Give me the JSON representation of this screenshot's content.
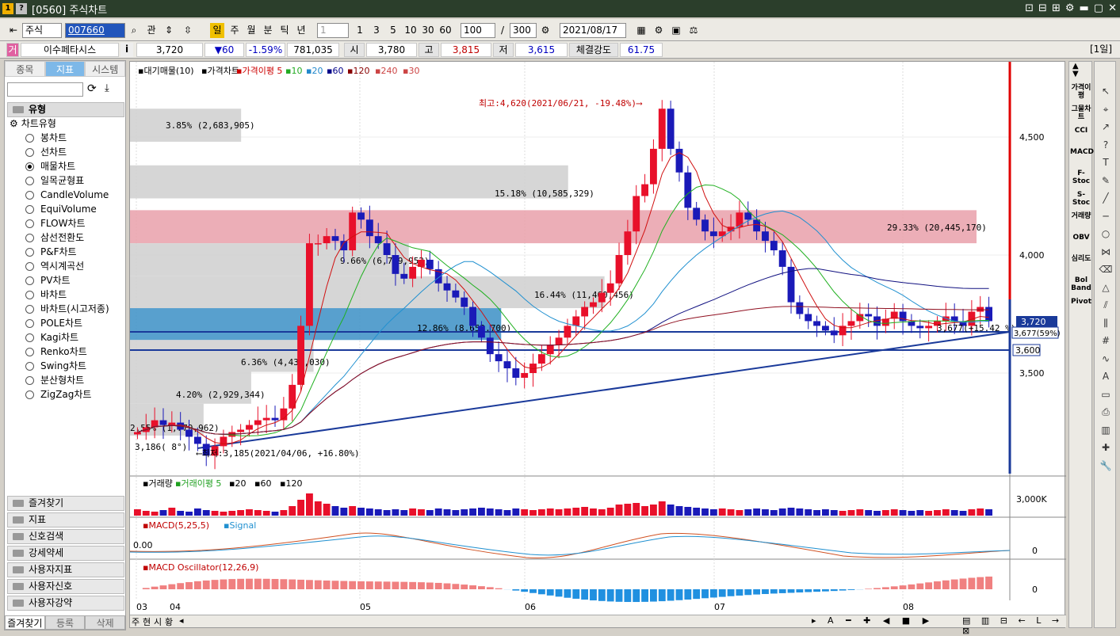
{
  "window": {
    "title": "[0560] 주식차트",
    "logo1": "1",
    "logo2": "?",
    "controls": [
      "⊡",
      "⊟",
      "⊞",
      "⚙",
      "▬",
      "▢",
      "✕"
    ]
  },
  "toolbar": {
    "market": "주식",
    "code": "007660",
    "gwan": "관",
    "periods": [
      "일",
      "주",
      "월",
      "분",
      "틱",
      "년"
    ],
    "tick_select": "1",
    "tick_options": [
      "1",
      "3",
      "5",
      "10",
      "30",
      "60"
    ],
    "count": "100",
    "total": "300",
    "date": "2021/08/17"
  },
  "info": {
    "name": "이수페타시스",
    "price": "3,720",
    "change": "▼60",
    "change_pct": "-1.59%",
    "volume": "781,035",
    "open_label": "시",
    "open": "3,780",
    "high_label": "고",
    "high": "3,815",
    "low_label": "저",
    "low": "3,615",
    "strength_label": "체결강도",
    "strength": "61.75",
    "period_badge": "[1일]",
    "prefix": "거",
    "i": "i"
  },
  "left": {
    "tabs": [
      "종목",
      "지표",
      "시스템"
    ],
    "section": "유형",
    "tree_label": "차트유형",
    "chart_types": [
      "봉차트",
      "선차트",
      "매물차트",
      "일목균형표",
      "CandleVolume",
      "EquiVolume",
      "FLOW차트",
      "삼선전환도",
      "P&F차트",
      "역시계곡선",
      "PV차트",
      "바차트",
      "바차트(시고저종)",
      "POLE차트",
      "Kagi차트",
      "Renko차트",
      "Swing차트",
      "분산형차트",
      "ZigZag차트"
    ],
    "selected_index": 2,
    "sections": [
      "즐겨찾기",
      "지표",
      "신호검색",
      "강세약세",
      "사용자지표",
      "사용자신호",
      "사용자강약"
    ],
    "bottom_tabs": [
      "즐겨찾기",
      "등록",
      "삭제"
    ]
  },
  "chart": {
    "legend_main": [
      "대기매물(10)",
      "가격차트",
      "가격이평 5",
      "10",
      "20",
      "60",
      "120",
      "240",
      "30"
    ],
    "legend_colors": [
      "#000",
      "#000",
      "#c00",
      "#2a2",
      "#28c",
      "#008",
      "#800",
      "#c44",
      "#c44"
    ],
    "profile_labels": [
      "3.85% (2,683,905)",
      "15.18% (10,585,329)",
      "29.33% (20,445,170)",
      "9.66% (6,739,952)",
      "16.44% (11,460,456)",
      "12.86% (8,652,700)",
      "6.36% (4,434,030)",
      "4.20% (2,929,344)",
      "2.55% (1,779,962)",
      "3,186(  8°)"
    ],
    "high_note": "최고:4,620(2021/06/21, -19.48%)⟶",
    "low_note": "⟵최저:3,185(2021/04/06, +16.80%)",
    "last_note": "3,677(+15.42 %)",
    "y_ticks": [
      "4,500",
      "4,000",
      "3,500"
    ],
    "price_tag": "3,720",
    "price_tag2": "3,677(59%)",
    "line_tag": "3,600",
    "vol_legend": [
      "거래량",
      "거래이평 5",
      "20",
      "60",
      "120"
    ],
    "vol_tick": "3,000K",
    "macd_legend": [
      "MACD(5,25,5)",
      "Signal"
    ],
    "macd_value": "0.00",
    "macd_tick": "0",
    "osc_legend": "MACD Oscillator(12,26,9)",
    "osc_tick": "0",
    "x_labels": [
      "03",
      "04",
      "05",
      "06",
      "07",
      "08"
    ],
    "bottom_buttons": [
      "주",
      "현",
      "시",
      "황"
    ]
  },
  "right_indicators": [
    "가격이평",
    "그물차트",
    "CCI",
    "MACD",
    "F-Stoc",
    "S-Stoc",
    "거래량",
    "OBV",
    "심리도",
    "Bol Band",
    "Pivot"
  ],
  "tools": [
    "pointer-icon",
    "cross-icon",
    "trend-icon",
    "question-icon",
    "text-icon",
    "pen-icon",
    "line-icon",
    "hline-icon",
    "circle-icon",
    "fib-icon",
    "eraser-icon",
    "tri-icon",
    "pitch-icon",
    "bars-icon",
    "grid-icon",
    "wave-icon",
    "auto-icon",
    "window-icon",
    "print-icon",
    "chart-icon",
    "plus-icon",
    "wrench-icon"
  ]
}
